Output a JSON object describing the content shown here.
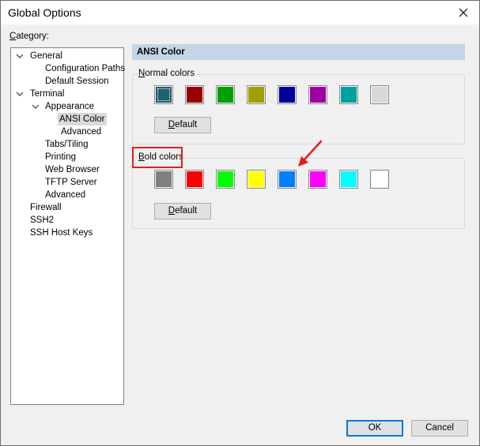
{
  "window": {
    "title": "Global Options"
  },
  "category": {
    "label_underlined": "C",
    "label_rest": "ategory:"
  },
  "tree": [
    {
      "label": "General",
      "expanded": true
    },
    {
      "label": "Configuration Paths"
    },
    {
      "label": "Default Session"
    },
    {
      "label": "Terminal",
      "expanded": true
    },
    {
      "label": "Appearance",
      "expanded": true
    },
    {
      "label": "ANSI Color",
      "selected": true
    },
    {
      "label": "Advanced"
    },
    {
      "label": "Tabs/Tiling"
    },
    {
      "label": "Printing"
    },
    {
      "label": "Web Browser"
    },
    {
      "label": "TFTP Server"
    },
    {
      "label": "Advanced"
    },
    {
      "label": "Firewall"
    },
    {
      "label": "SSH2"
    },
    {
      "label": "SSH Host Keys"
    }
  ],
  "panel": {
    "header": "ANSI Color"
  },
  "normal_colors": {
    "label_underlined": "N",
    "label_rest": "ormal colors",
    "swatches": [
      "#1f5f6f",
      "#990000",
      "#00a000",
      "#a0a000",
      "#000099",
      "#a000a0",
      "#00a0a0",
      "#d8d8d8"
    ],
    "default_underlined": "D",
    "default_rest": "efault"
  },
  "bold_colors": {
    "label_underlined": "B",
    "label_rest": "old colors",
    "swatches": [
      "#808080",
      "#ff0000",
      "#00ff00",
      "#ffff00",
      "#0080ff",
      "#ff00ff",
      "#00ffff",
      "#ffffff"
    ],
    "default_underlined": "D",
    "default_rest": "efault"
  },
  "buttons": {
    "ok": "OK",
    "cancel": "Cancel"
  },
  "annotation_colors": {
    "highlight": "#e02020",
    "arrow": "#e02020"
  },
  "icons": {
    "close": "close-icon",
    "chevron": "chevron-down-icon",
    "arrow": "red-arrow-annotation"
  }
}
